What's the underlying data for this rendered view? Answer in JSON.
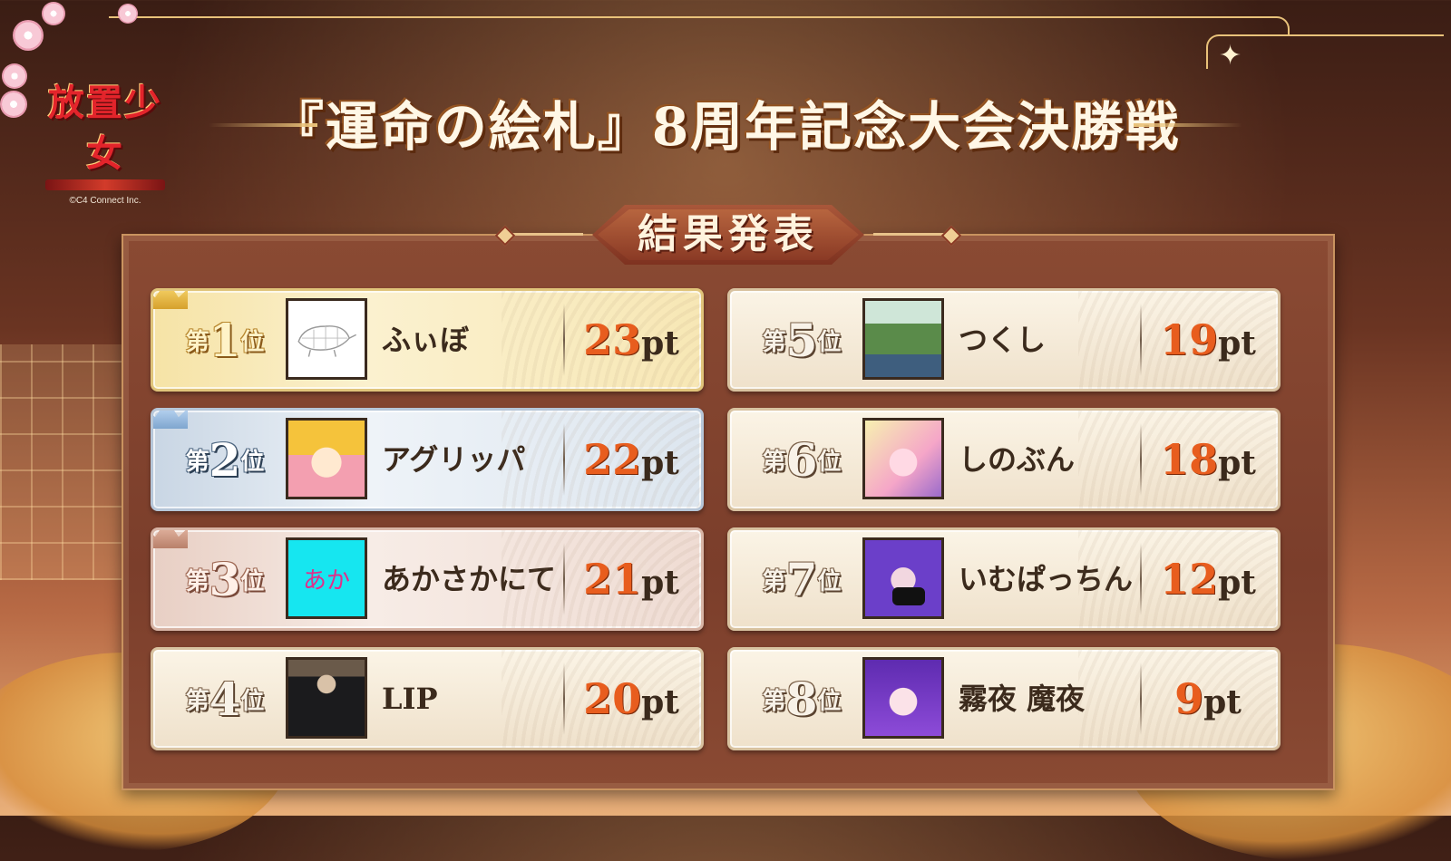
{
  "logo": {
    "game_name": "放置少女",
    "copyright": "©C4 Connect Inc."
  },
  "title": "『運命の絵札』8周年記念大会決勝戦",
  "board": {
    "heading": "結果発表"
  },
  "rankings": [
    {
      "rank_prefix": "第",
      "rank_num": "1",
      "rank_suffix": "位",
      "name": "ふぃぼ",
      "points": "23",
      "unit": "pt",
      "avatar_icon": "sketch-avatar"
    },
    {
      "rank_prefix": "第",
      "rank_num": "2",
      "rank_suffix": "位",
      "name": "アグリッパ",
      "points": "22",
      "unit": "pt",
      "avatar_icon": "anime-girl-avatar"
    },
    {
      "rank_prefix": "第",
      "rank_num": "3",
      "rank_suffix": "位",
      "name": "あかさかにて",
      "points": "21",
      "unit": "pt",
      "avatar_icon": "text-avatar",
      "avatar_text": "あか"
    },
    {
      "rank_prefix": "第",
      "rank_num": "4",
      "rank_suffix": "位",
      "name": "LIP",
      "points": "20",
      "unit": "pt",
      "avatar_icon": "suited-man-avatar"
    },
    {
      "rank_prefix": "第",
      "rank_num": "5",
      "rank_suffix": "位",
      "name": "つくし",
      "points": "19",
      "unit": "pt",
      "avatar_icon": "painting-avatar"
    },
    {
      "rank_prefix": "第",
      "rank_num": "6",
      "rank_suffix": "位",
      "name": "しのぶん",
      "points": "18",
      "unit": "pt",
      "avatar_icon": "fairy-girl-avatar"
    },
    {
      "rank_prefix": "第",
      "rank_num": "7",
      "rank_suffix": "位",
      "name": "いむぱっちん",
      "points": "12",
      "unit": "pt",
      "avatar_icon": "masked-girl-avatar"
    },
    {
      "rank_prefix": "第",
      "rank_num": "8",
      "rank_suffix": "位",
      "name": "霧夜 魔夜",
      "points": "9",
      "unit": "pt",
      "avatar_icon": "purple-hair-girl-avatar"
    }
  ],
  "colors": {
    "points": "#e85d1e",
    "board": "#7b3e2b",
    "gold": "#f6e3a6",
    "silver": "#c9d6e4",
    "bronze": "#e8cfc4"
  }
}
